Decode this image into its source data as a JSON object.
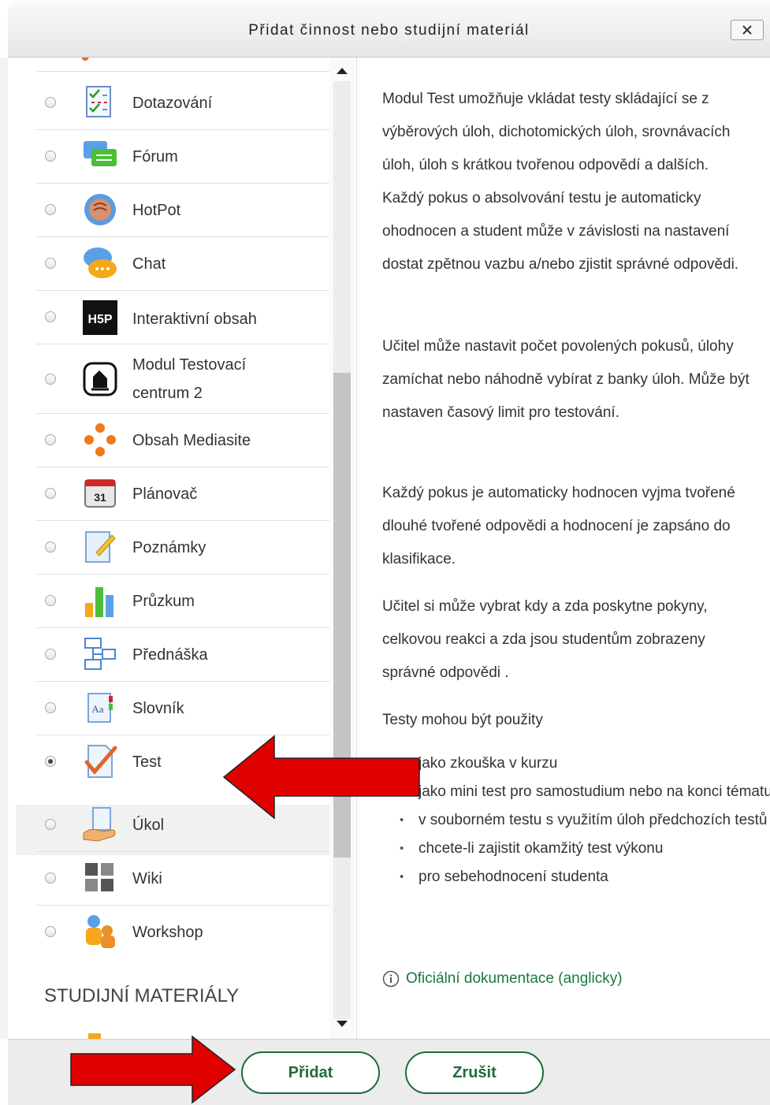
{
  "dialog": {
    "title": "Přidat činnost nebo studijní materiál",
    "close_label": "x"
  },
  "activities": [
    {
      "label": "Dotazování",
      "icon": "feedback-icon",
      "selected": false
    },
    {
      "label": "Fórum",
      "icon": "forum-icon",
      "selected": false
    },
    {
      "label": "HotPot",
      "icon": "hotpot-icon",
      "selected": false
    },
    {
      "label": "Chat",
      "icon": "chat-icon",
      "selected": false
    },
    {
      "label": "Interaktivní obsah",
      "icon": "h5p-icon",
      "selected": false
    },
    {
      "label": "Modul Testovací centrum 2",
      "icon": "testing-centre-icon",
      "selected": false
    },
    {
      "label": "Obsah Mediasite",
      "icon": "mediasite-icon",
      "selected": false
    },
    {
      "label": "Plánovač",
      "icon": "scheduler-icon",
      "selected": false
    },
    {
      "label": "Poznámky",
      "icon": "notes-icon",
      "selected": false
    },
    {
      "label": "Průzkum",
      "icon": "survey-icon",
      "selected": false
    },
    {
      "label": "Přednáška",
      "icon": "lesson-icon",
      "selected": false
    },
    {
      "label": "Slovník",
      "icon": "glossary-icon",
      "selected": false
    },
    {
      "label": "Test",
      "icon": "quiz-icon",
      "selected": true
    },
    {
      "label": "Úkol",
      "icon": "assignment-icon",
      "selected": false
    },
    {
      "label": "Wiki",
      "icon": "wiki-icon",
      "selected": false
    },
    {
      "label": "Workshop",
      "icon": "workshop-icon",
      "selected": false
    }
  ],
  "resources_section_label": "STUDIJNÍ MATERIÁLY",
  "help": {
    "paragraphs": [
      "Modul Test umožňuje vkládat testy skládající se z výběrových úloh, dichotomických úloh, srovnávacích úloh, úloh s krátkou tvořenou odpovědí a dalších. Každý pokus o absolvování testu je automaticky ohodnocen a student může v závislosti na nastavení dostat zpětnou vazbu a/nebo zjistit správné odpovědi.",
      "Učitel může nastavit počet povolených pokusů, úlohy zamíchat nebo náhodně vybírat z banky úloh. Může být nastaven časový limit pro testování.",
      "Každý pokus je automaticky hodnocen vyjma tvořené dlouhé tvořené odpovědi a hodnocení je zapsáno do klasifikace.",
      "Učitel si může vybrat kdy a zda poskytne pokyny, celkovou reakci a zda jsou studentům zobrazeny správné odpovědi .",
      "Testy mohou být použity"
    ],
    "uses": [
      "jako zkouška v kurzu",
      "jako mini test pro samostudium nebo na konci tématu",
      "v souborném testu s využitím úloh předchozích testů",
      "chcete-li zajistit okamžitý test výkonu",
      "pro sebehodnocení studenta"
    ],
    "doc_link": "Oficiální dokumentace (anglicky)"
  },
  "footer": {
    "add_label": "Přidat",
    "cancel_label": "Zrušit"
  },
  "colors": {
    "accent": "#1f6b3a",
    "link": "#1a7a3a",
    "annotation_arrow": "#e10000"
  }
}
